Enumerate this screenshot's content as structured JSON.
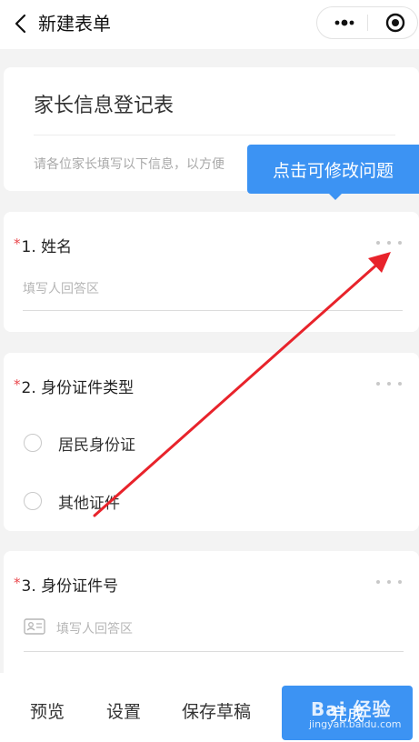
{
  "nav": {
    "title": "新建表单"
  },
  "form": {
    "title": "家长信息登记表",
    "description": "请各位家长填写以下信息，以方便"
  },
  "tooltip": {
    "text": "点击可修改问题"
  },
  "questions": [
    {
      "required_mark": "*",
      "title": "1. 姓名",
      "placeholder": "填写人回答区"
    },
    {
      "required_mark": "*",
      "title": "2. 身份证件类型",
      "options": [
        "居民身份证",
        "其他证件"
      ]
    },
    {
      "required_mark": "*",
      "title": "3. 身份证件号",
      "placeholder": "填写人回答区"
    }
  ],
  "bottom": {
    "preview": "预览",
    "settings": "设置",
    "save_draft": "保存草稿",
    "done": "完成"
  },
  "watermark": {
    "main": "Bai 经验",
    "url": "jingyan.baidu.com"
  },
  "colors": {
    "accent": "#3c93f3",
    "required": "#e9464b",
    "annotation": "#e8232b"
  }
}
